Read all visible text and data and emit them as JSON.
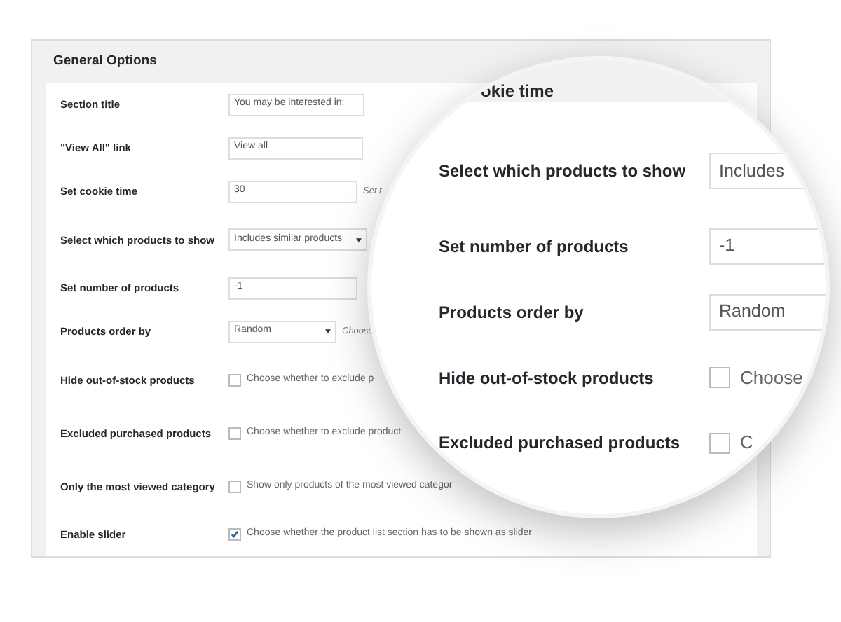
{
  "panel": {
    "title": "General Options"
  },
  "options": [
    {
      "label": "Section title",
      "kind": "text",
      "value": "You may be interested in:"
    },
    {
      "label": "\"View All\" link",
      "kind": "text",
      "value": "View all"
    },
    {
      "label": "Set cookie time",
      "kind": "number",
      "value": "30",
      "note": "Set t"
    },
    {
      "label": "Select which products to show",
      "kind": "select",
      "value": "Includes similar products"
    },
    {
      "label": "Set number of products",
      "kind": "number",
      "value": "-1"
    },
    {
      "label": "Products order by",
      "kind": "select",
      "value": "Random",
      "note": "Choose"
    },
    {
      "label": "Hide out-of-stock products",
      "kind": "checkbox",
      "checked": false,
      "description": "Choose whether to exclude p"
    },
    {
      "label": "Excluded purchased products",
      "kind": "checkbox",
      "checked": false,
      "description": "Choose whether to exclude product"
    },
    {
      "label": "Only the most viewed category",
      "kind": "checkbox",
      "checked": false,
      "description": "Show only products of the most viewed categor"
    },
    {
      "label": "Enable slider",
      "kind": "checkbox",
      "checked": true,
      "description": "Choose whether the product list section has to be shown as slider"
    }
  ],
  "magnifier": {
    "rows": [
      {
        "label": "okie time",
        "kind": "heading"
      },
      {
        "label": "Select which products to show",
        "kind": "select",
        "value": "Includes"
      },
      {
        "label": "Set number of products",
        "kind": "number",
        "value": "-1"
      },
      {
        "label": "Products order by",
        "kind": "select",
        "value": "Random"
      },
      {
        "label": "Hide out-of-stock products",
        "kind": "checkbox",
        "checked": false,
        "description": "Choose"
      },
      {
        "label": "Excluded purchased products",
        "kind": "checkbox",
        "checked": false,
        "description": "C"
      }
    ]
  }
}
